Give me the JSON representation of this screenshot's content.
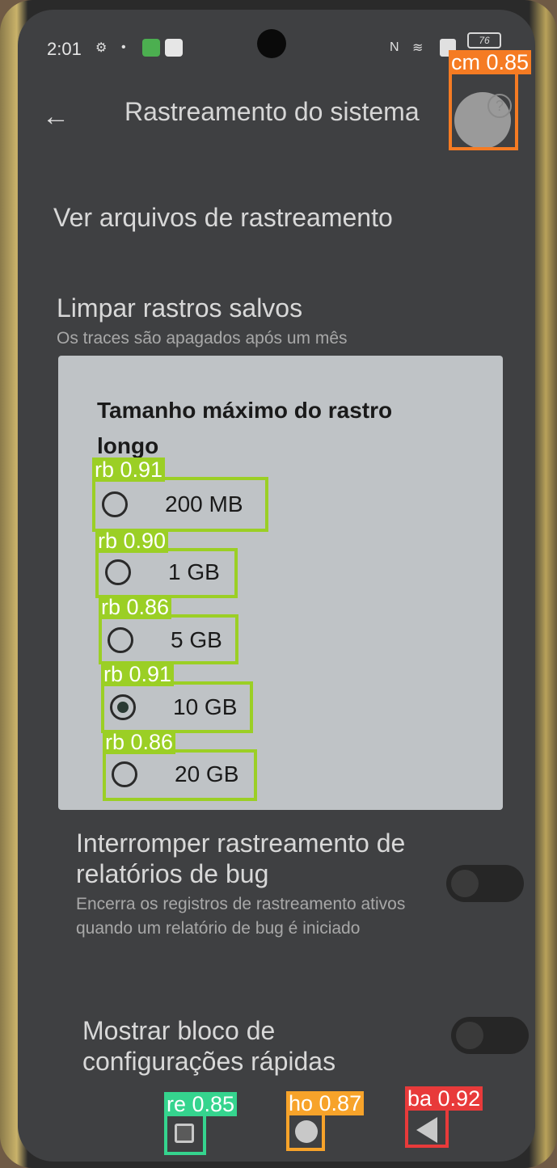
{
  "status_bar": {
    "time": "2:01",
    "battery": "76"
  },
  "header": {
    "title": "Rastreamento do sistema"
  },
  "settings": {
    "view_traces": {
      "title": "Ver arquivos de rastreamento"
    },
    "clear_traces": {
      "title": "Limpar rastros salvos",
      "subtitle": "Os traces são apagados após um mês"
    },
    "stop_on_bugreport": {
      "title": "Interromper rastreamento de relatórios de bug",
      "subtitle": "Encerra os registros de rastreamento ativos quando um relatório de bug é iniciado",
      "enabled": false
    },
    "quick_settings_tile": {
      "title": "Mostrar bloco de configurações rápidas",
      "enabled": false
    }
  },
  "dialog": {
    "title": "Tamanho máximo do rastro longo",
    "options": [
      {
        "label": "200 MB",
        "checked": false
      },
      {
        "label": "1 GB",
        "checked": false
      },
      {
        "label": "5 GB",
        "checked": false
      },
      {
        "label": "10 GB",
        "checked": true
      },
      {
        "label": "20 GB",
        "checked": false
      }
    ]
  },
  "detections": {
    "help": "cm 0.85",
    "rb_200mb": "rb 0.91",
    "rb_1gb": "rb 0.90",
    "rb_5gb": "rb 0.86",
    "rb_10gb": "rb 0.91",
    "rb_20gb": "rb 0.86",
    "recents": "re 0.85",
    "home": "ho 0.87",
    "back": "ba 0.92"
  },
  "colors": {
    "radio_box": "#9bcf25",
    "help_box": "#f57b23",
    "recents_box": "#35d48e",
    "home_box": "#f7a32a",
    "back_box": "#e83a3a"
  },
  "icons": {
    "back": "arrow-left",
    "help": "question-circle",
    "nav_recents": "square",
    "nav_home": "circle",
    "nav_back": "triangle-left"
  }
}
